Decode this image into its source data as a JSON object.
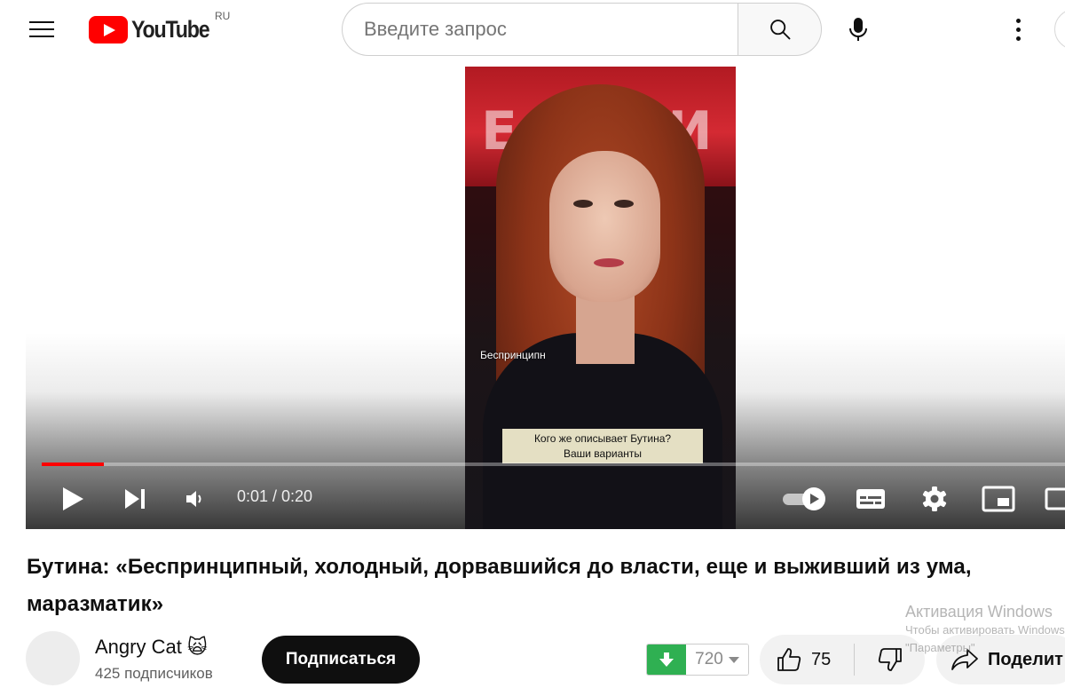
{
  "header": {
    "logo_text": "YouTube",
    "region": "RU",
    "search_placeholder": "Введите запрос",
    "icons": [
      "menu-icon",
      "youtube-logo",
      "search-icon",
      "mic-icon",
      "more-vert-icon"
    ]
  },
  "player": {
    "time": "0:01 / 0:20",
    "progress_fraction": 0.06,
    "frame_caption": "Беспринципн",
    "frame_subtitle_line1": "Кого же описывает Бутина?",
    "frame_subtitle_line2": "Ваши варианты",
    "autoplay_on": true,
    "controls": [
      "play-icon",
      "next-icon",
      "volume-icon",
      "autoplay-toggle",
      "subtitles-icon",
      "settings-icon",
      "miniplayer-icon",
      "theater-icon"
    ]
  },
  "video": {
    "title": "Бутина: «Беспринципный, холодный, дорвавшийся до власти, еще и выживший из ума, маразматик»"
  },
  "channel": {
    "name": "Angry Cat 🙀",
    "subscribers": "425 подписчиков",
    "subscribe_label": "Подписаться"
  },
  "actions": {
    "download_count": "720",
    "like_count": "75",
    "share_label": "Поделит"
  },
  "watermark": {
    "title": "Активация Windows",
    "line1": "Чтобы активировать Windows",
    "line2": "\"Параметры\""
  },
  "colors": {
    "brand_red": "#ff0000",
    "subscribe_bg": "#0f0f0f",
    "download_green": "#2fb052"
  }
}
